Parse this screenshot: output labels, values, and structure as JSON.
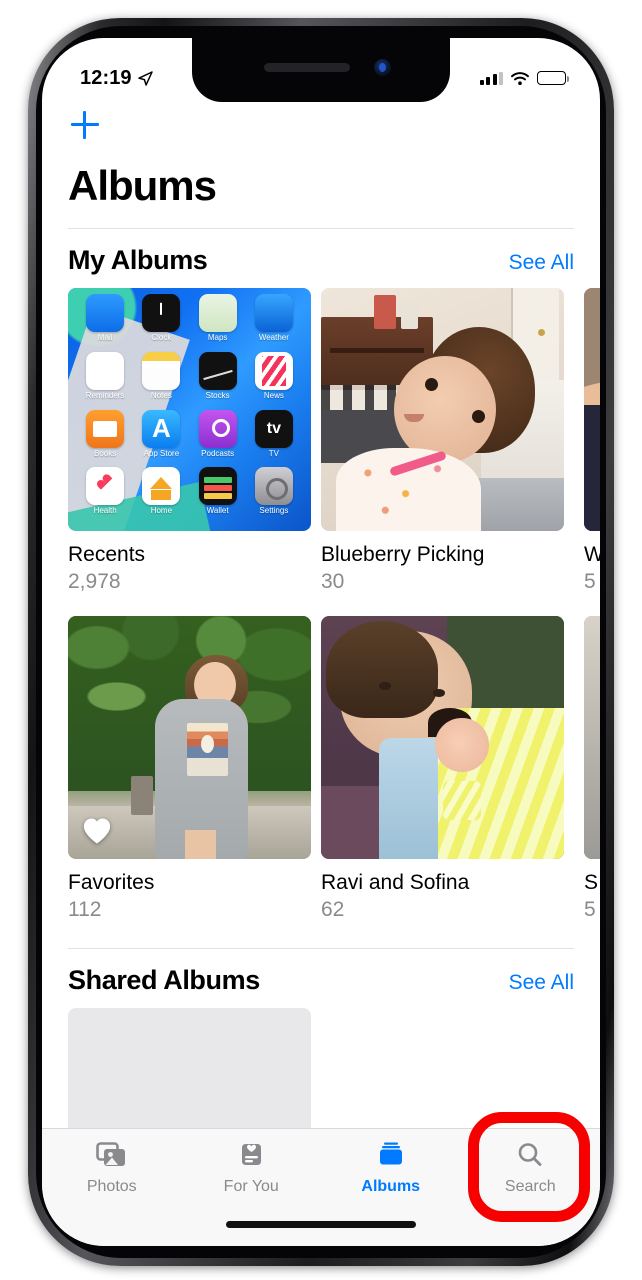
{
  "status_bar": {
    "time": "12:19",
    "location_icon": "location-arrow-icon",
    "cellular_icon": "cellular-signal-icon",
    "wifi_icon": "wifi-icon",
    "battery_icon": "battery-full-icon"
  },
  "nav": {
    "add_button_icon": "plus-icon",
    "title": "Albums"
  },
  "sections": [
    {
      "title": "My Albums",
      "see_all_label": "See All",
      "albums": [
        {
          "name": "Recents",
          "count": "2,978",
          "thumb": "home-screen-screenshot"
        },
        {
          "name": "Blueberry Picking",
          "count": "30",
          "thumb": "baby-on-bed-photo"
        },
        {
          "name": "W",
          "count": "5",
          "thumb": "cropped-photo-right-edge"
        },
        {
          "name": "Favorites",
          "count": "112",
          "thumb": "woman-outdoors-photo",
          "badge_icon": "heart-icon"
        },
        {
          "name": "Ravi and Sofina",
          "count": "62",
          "thumb": "adult-and-newborn-photo"
        },
        {
          "name": "S",
          "count": "5",
          "thumb": "cropped-photo-right-edge-2"
        }
      ]
    },
    {
      "title": "Shared Albums",
      "see_all_label": "See All",
      "albums": [
        {
          "name": "",
          "count": "",
          "thumb": "empty-placeholder"
        }
      ]
    }
  ],
  "home_screen_apps": [
    {
      "label": "Mail"
    },
    {
      "label": "Clock"
    },
    {
      "label": "Maps"
    },
    {
      "label": "Weather"
    },
    {
      "label": "Reminders"
    },
    {
      "label": "Notes"
    },
    {
      "label": "Stocks"
    },
    {
      "label": "News"
    },
    {
      "label": "Books"
    },
    {
      "label": "App Store"
    },
    {
      "label": "Podcasts"
    },
    {
      "label": "TV"
    },
    {
      "label": "Health"
    },
    {
      "label": "Home"
    },
    {
      "label": "Wallet"
    },
    {
      "label": "Settings"
    }
  ],
  "tab_bar": {
    "items": [
      {
        "label": "Photos",
        "icon": "photos-icon",
        "active": false
      },
      {
        "label": "For You",
        "icon": "for-you-icon",
        "active": false
      },
      {
        "label": "Albums",
        "icon": "albums-icon",
        "active": true
      },
      {
        "label": "Search",
        "icon": "search-icon",
        "active": false
      }
    ]
  },
  "annotation": {
    "target": "Search",
    "shape": "rounded-rectangle-outline",
    "color": "#F60000"
  },
  "colors": {
    "accent": "#007AFF",
    "secondary_text": "#8A8A8E",
    "annotation_red": "#F60000",
    "background": "#FFFFFF"
  }
}
